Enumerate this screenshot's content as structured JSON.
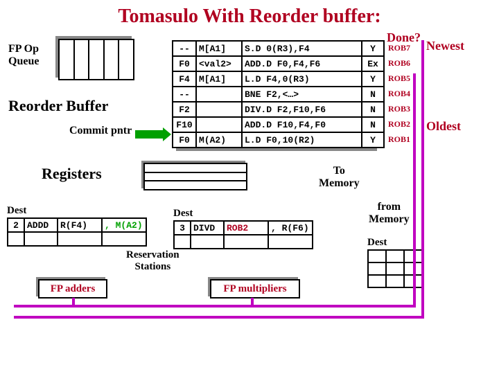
{
  "title": "Tomasulo With Reorder buffer:",
  "done_label": "Done?",
  "fp_op_label": "FP Op\nQueue",
  "reorder_buffer_label": "Reorder Buffer",
  "commit_label": "Commit pntr",
  "newest_label": "Newest",
  "oldest_label": "Oldest",
  "rob_rows": [
    {
      "dest": "--",
      "val": "M[A1]",
      "instr": "S.D 0(R3),F4",
      "done": "Y",
      "tag": "ROB7"
    },
    {
      "dest": "F0",
      "val": "<val2>",
      "instr": "ADD.D F0,F4,F6",
      "done": "Ex",
      "tag": "ROB6"
    },
    {
      "dest": "F4",
      "val": "M[A1]",
      "instr": "L.D F4,0(R3)",
      "done": "Y",
      "tag": "ROB5"
    },
    {
      "dest": "--",
      "val": "",
      "instr": "BNE F2,<…>",
      "done": "N",
      "tag": "ROB4"
    },
    {
      "dest": "F2",
      "val": "",
      "instr": "DIV.D F2,F10,F6",
      "done": "N",
      "tag": "ROB3"
    },
    {
      "dest": "F10",
      "val": "",
      "instr": "ADD.D F10,F4,F0",
      "done": "N",
      "tag": "ROB2"
    },
    {
      "dest": "F0",
      "val": "M(A2)",
      "instr": "L.D F0,10(R2)",
      "done": "Y",
      "tag": "ROB1"
    }
  ],
  "registers_label": "Registers",
  "to_memory": "To\nMemory",
  "from_memory": "from\nMemory",
  "dest_label": "Dest",
  "rs_add": {
    "id": "2",
    "op": "ADDD",
    "s1": "R(F4)",
    "s2": "M(A2)"
  },
  "rs_mul": {
    "id": "3",
    "op": "DIVD",
    "s1": "ROB2",
    "s2": "R(F6)"
  },
  "rs_label": "Reservation\nStations",
  "fu_add": "FP adders",
  "fu_mul": "FP multipliers"
}
